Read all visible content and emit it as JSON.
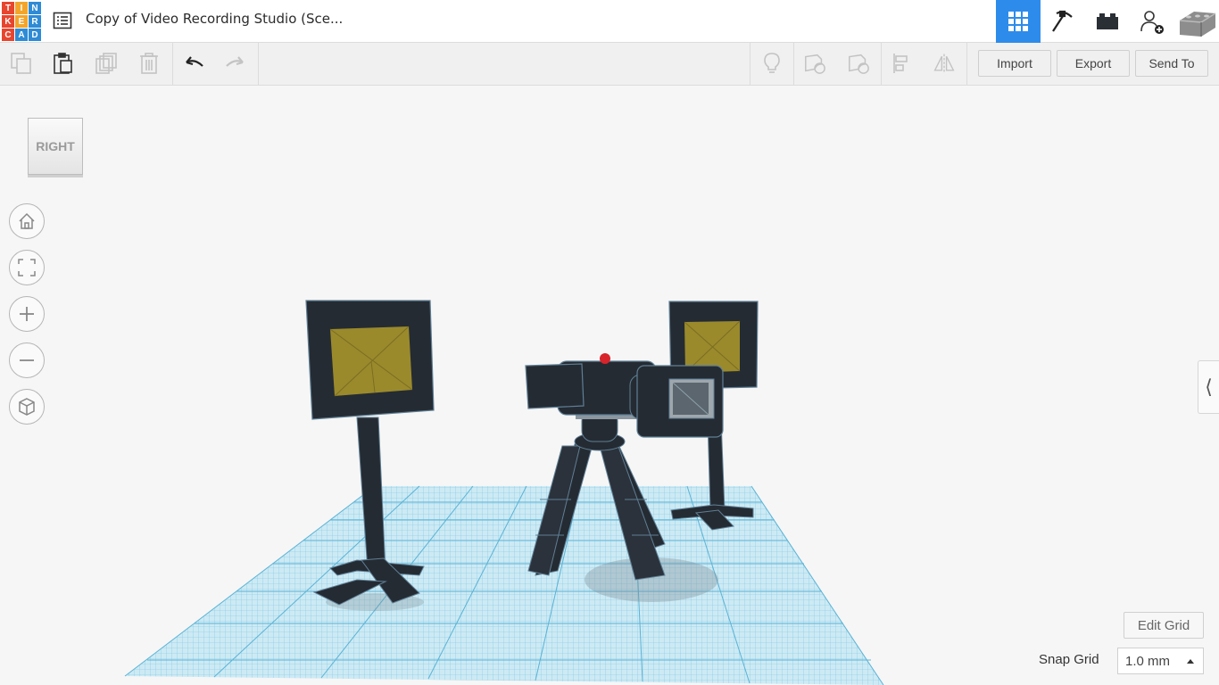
{
  "app": {
    "logo_letters": [
      "T",
      "I",
      "N",
      "K",
      "E",
      "R",
      "C",
      "A",
      "D"
    ],
    "logo_colors": [
      "#e8452f",
      "#f3a52b",
      "#2e8bd6",
      "#e8452f",
      "#f3a52b",
      "#2e8bd6",
      "#e8452f",
      "#2e8bd6",
      "#2e8bd6"
    ],
    "title": "Copy of Video Recording Studio (Sce..."
  },
  "topbar": {
    "icons": [
      "3d-design-grid-icon",
      "codeblocks-pickaxe-icon",
      "bricks-icon",
      "add-user-icon",
      "user-avatar"
    ],
    "active_color": "#2d8ceb"
  },
  "toolbar": {
    "left_icons": [
      "copy-icon",
      "paste-icon",
      "duplicate-icon",
      "delete-icon",
      "undo-icon",
      "redo-icon"
    ],
    "right_icons": [
      "light-bulb-icon",
      "solid-shape-icon",
      "hole-shape-icon",
      "align-icon",
      "mirror-icon"
    ],
    "import_label": "Import",
    "export_label": "Export",
    "send_to_label": "Send To"
  },
  "viewcube": {
    "face_label": "RIGHT"
  },
  "nav_controls": [
    "home-view-icon",
    "fit-view-icon",
    "zoom-in-icon",
    "zoom-out-icon",
    "ortho-perspective-icon"
  ],
  "workplane": {
    "grid_color": "#7ecbe6",
    "model_color": "#252b33",
    "panel_color": "#9a8a2c",
    "accent_red": "#d8232a"
  },
  "footer": {
    "edit_grid_label": "Edit Grid",
    "snap_grid_label": "Snap Grid",
    "snap_grid_value": "1.0 mm"
  },
  "side_panel_toggle": "⟨"
}
